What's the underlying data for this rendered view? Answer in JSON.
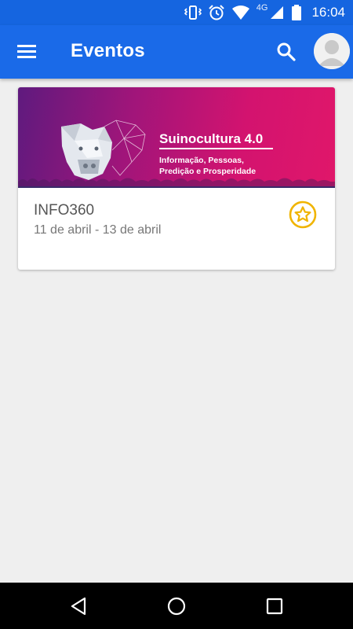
{
  "status_bar": {
    "time": "16:04",
    "network_label": "4G",
    "icons": [
      "vibrate-icon",
      "alarm-icon",
      "wifi-icon",
      "cell-signal-icon",
      "battery-icon"
    ]
  },
  "app_bar": {
    "title": "Eventos",
    "icons": [
      "menu-icon",
      "search-icon",
      "avatar"
    ],
    "color": "#1a6ae8"
  },
  "events": [
    {
      "banner": {
        "title": "Suinocultura 4.0",
        "subtitle_line1": "Informação, Pessoas,",
        "subtitle_line2": "Predição e Prosperidade"
      },
      "name": "INFO360",
      "dates": "11 de abril - 13 de abril",
      "favorite_icon": "star-outline-icon",
      "favorite_color": "#f0b400"
    }
  ],
  "nav_bar": {
    "icons": [
      "back-icon",
      "home-icon",
      "recents-icon"
    ]
  }
}
